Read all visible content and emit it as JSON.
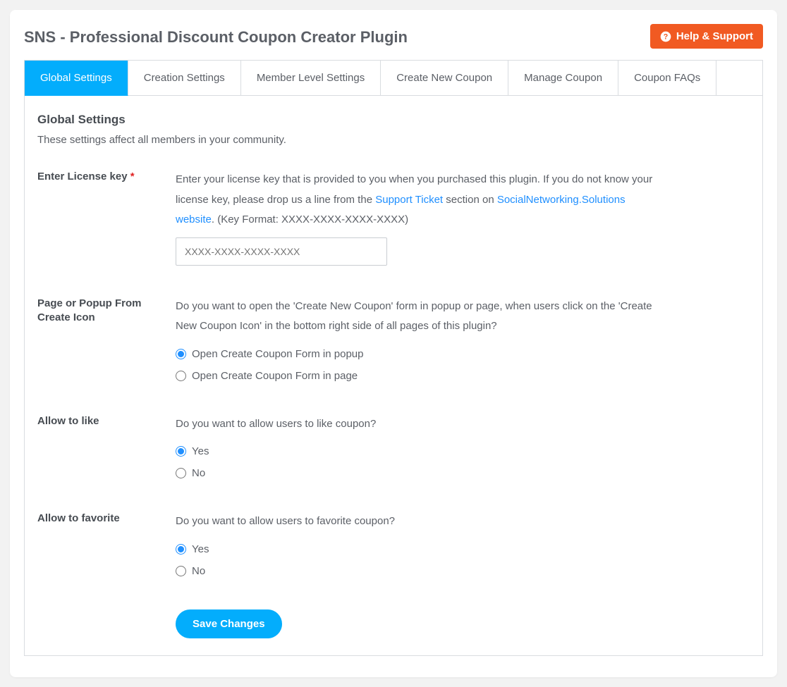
{
  "header": {
    "title": "SNS - Professional Discount Coupon Creator Plugin",
    "help_label": "Help & Support"
  },
  "tabs": [
    {
      "label": "Global Settings",
      "active": true
    },
    {
      "label": "Creation Settings",
      "active": false
    },
    {
      "label": "Member Level Settings",
      "active": false
    },
    {
      "label": "Create New Coupon",
      "active": false
    },
    {
      "label": "Manage Coupon",
      "active": false
    },
    {
      "label": "Coupon FAQs",
      "active": false
    }
  ],
  "panel": {
    "title": "Global Settings",
    "description": "These settings affect all members in your community."
  },
  "fields": {
    "license": {
      "label": "Enter License key",
      "required_mark": "*",
      "desc_part1": "Enter your license key that is provided to you when you purchased this plugin. If you do not know your license key, please drop us a line from the ",
      "link1": "Support Ticket",
      "desc_part2": " section on ",
      "link2": "SocialNetworking.Solutions website",
      "desc_part3": ". (Key Format: XXXX-XXXX-XXXX-XXXX)",
      "placeholder": "XXXX-XXXX-XXXX-XXXX",
      "value": ""
    },
    "open_form": {
      "label": "Page or Popup From Create Icon",
      "desc": "Do you want to open the 'Create New Coupon' form in popup or page, when users click on the 'Create New Coupon Icon' in the bottom right side of all pages of this plugin?",
      "options": [
        {
          "label": "Open Create Coupon Form in popup",
          "checked": true
        },
        {
          "label": "Open Create Coupon Form in page",
          "checked": false
        }
      ]
    },
    "allow_like": {
      "label": "Allow to like",
      "desc": "Do you want to allow users to like coupon?",
      "options": [
        {
          "label": "Yes",
          "checked": true
        },
        {
          "label": "No",
          "checked": false
        }
      ]
    },
    "allow_favorite": {
      "label": "Allow to favorite",
      "desc": "Do you want to allow users to favorite coupon?",
      "options": [
        {
          "label": "Yes",
          "checked": true
        },
        {
          "label": "No",
          "checked": false
        }
      ]
    }
  },
  "submit": {
    "label": "Save Changes"
  }
}
